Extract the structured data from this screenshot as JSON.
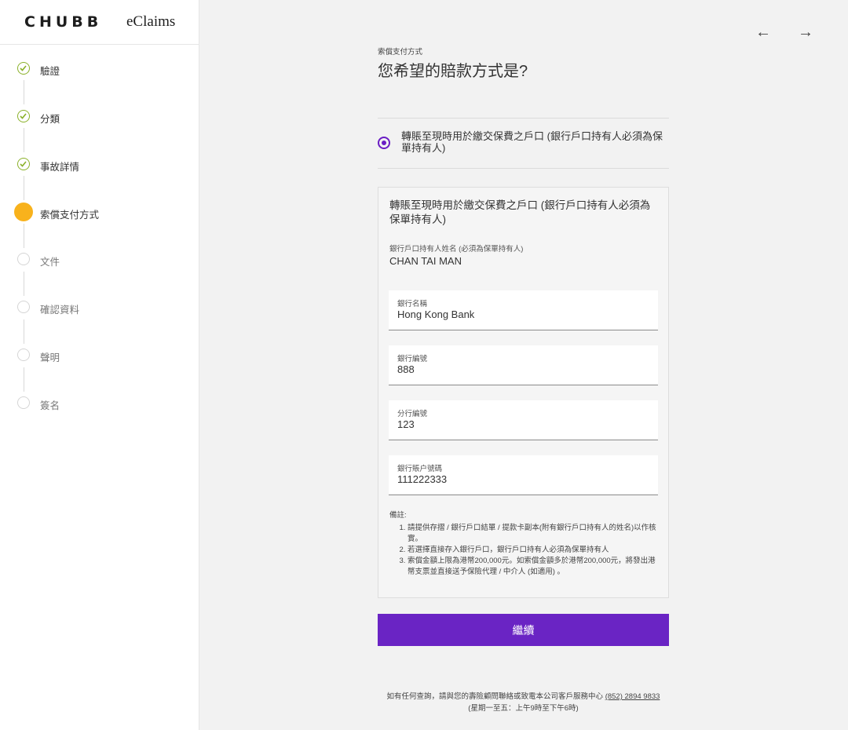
{
  "brand": {
    "logo": "CHUBB",
    "product": "eClaims"
  },
  "steps": [
    {
      "label": "驗證",
      "state": "done"
    },
    {
      "label": "分類",
      "state": "done"
    },
    {
      "label": "事故詳情",
      "state": "done"
    },
    {
      "label": "索償支付方式",
      "state": "current"
    },
    {
      "label": "文件",
      "state": "pending"
    },
    {
      "label": "確認資料",
      "state": "pending"
    },
    {
      "label": "聲明",
      "state": "pending"
    },
    {
      "label": "簽名",
      "state": "pending"
    }
  ],
  "nav": {
    "back": "←",
    "forward": "→"
  },
  "page": {
    "eyebrow": "索償支付方式",
    "heading": "您希望的賠款方式是?"
  },
  "payment_option": {
    "label": "轉賬至現時用於繳交保費之戶口 (銀行戶口持有人必須為保單持有人)",
    "selected": true
  },
  "card": {
    "title": "轉賬至現時用於繳交保費之戶口 (銀行戶口持有人必須為保單持有人)",
    "holder_label": "銀行戶口持有人姓名 (必須為保單持有人)",
    "holder_value": "CHAN TAI MAN",
    "fields": [
      {
        "label": "銀行名稱",
        "value": "Hong Kong Bank"
      },
      {
        "label": "銀行編號",
        "value": "888"
      },
      {
        "label": "分行編號",
        "value": "123"
      },
      {
        "label": "銀行賬户號碼",
        "value": "111222333"
      }
    ],
    "notes_title": "備註:",
    "notes": [
      "請提供存摺 / 銀行戶口結單 / 提款卡副本(附有銀行戶口持有人的姓名)以作核實。",
      "若選擇直接存入銀行戶口，銀行戶口持有人必須為保單持有人",
      "索償金額上限為港幣200,000元。如索償金額多於港幣200,000元，將發出港幣支票並直接送予保險代理 / 中介人 (如適用) 。"
    ]
  },
  "continue_label": "繼續",
  "footer": {
    "line1": "如有任何查詢，請與您的壽險顧問聯絡或致電本公司客戶服務中心",
    "phone": "(852) 2894 9833",
    "line2": "(星期一至五：上午9時至下午6時)"
  },
  "colors": {
    "accent": "#6a24c4",
    "done": "#8bb12a",
    "current": "#f8b21c"
  }
}
